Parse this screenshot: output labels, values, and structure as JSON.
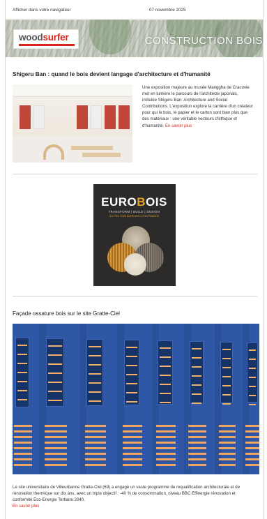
{
  "topbar": {
    "view_in_browser": "Afficher dans votre navigateur",
    "date": "07 novembre 2025"
  },
  "header": {
    "logo_part1": "wood",
    "logo_part2": "surfer",
    "banner_title": "CONSTRUCTION BOIS"
  },
  "article1": {
    "title": "Shigeru Ban : quand le bois devient langage d'architecture et d'humanité",
    "description": "Une exposition majeure au musée Manggha de Cracovie met en lumière le parcours de l'architecte japonais, intitulée Shigeru Ban: Architecture and Social Contributions. L'exposition explore la carrière d'un créateur pour qui le bois, le papier et le carton sont bien plus que des matériaux : une véritable vecteurs d'éthique et d'humanité.",
    "read_more": "En savoir plus"
  },
  "ad": {
    "title_a": "EURO",
    "title_o": "B",
    "title_b": "OIS",
    "subtitle": "TRANSFORM | BUILD | DESIGN",
    "dates": "3-6 FEV. 2026 EUREXPO LYON FRANCE"
  },
  "article2": {
    "title": "Façade ossature bois sur le site Gratte-Ciel",
    "description": "Le site universitaire de Villeurbanne Gratte-Ciel (69) a engagé un vaste programme de requalification architecturale et de rénovation thermique sur dix ans, avec un triple objectif : -40 % de consommation, niveau BBC Effinergie rénovation et conformité Eco-Energie Tertiaire 2040.",
    "read_more": "En savoir plus"
  },
  "colors": {
    "accent": "#d9261c",
    "facade_blue": "#2e57a6",
    "wood": "#f0a663",
    "ad_gold": "#e3a21f"
  }
}
